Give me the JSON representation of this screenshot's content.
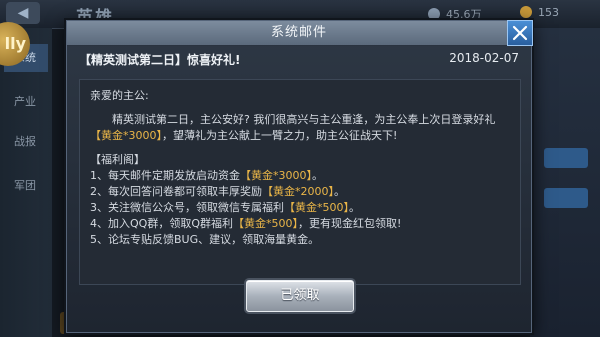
{
  "background": {
    "screen_title": "英雄",
    "resource_silver": "45.6万",
    "resource_gold": "153",
    "logo_text": "lly",
    "sidebar_items": [
      "系统",
      "产业",
      "战报",
      "军团"
    ]
  },
  "mail": {
    "header_title": "系统邮件",
    "subject": "【精英测试第二日】惊喜好礼!",
    "date": "2018-02-07",
    "greeting": "亲爱的主公:",
    "intro_a": "精英测试第二日，主公安好? 我们很高兴与主公重逢，为主公奉上次日登录好礼",
    "intro_gold": "【黄金*3000】",
    "intro_b": "，望薄礼为主公献上一臂之力，助主公征战天下!",
    "section_title": "【福利阁】",
    "items": [
      {
        "a": "1、每天邮件定期发放启动资金",
        "gold": "【黄金*3000】",
        "b": "。"
      },
      {
        "a": "2、每次回答问卷都可领取丰厚奖励",
        "gold": "【黄金*2000】",
        "b": "。"
      },
      {
        "a": "3、关注微信公众号，领取微信专属福利",
        "gold": "【黄金*500】",
        "b": "。"
      },
      {
        "a": "4、加入QQ群，领取Q群福利",
        "gold": "【黄金*500】",
        "b": "，更有现金红包领取!"
      },
      {
        "a": "5、论坛专贴反馈BUG、建议，领取海量黄金。",
        "gold": "",
        "b": ""
      }
    ],
    "claim_label": "已领取"
  },
  "colors": {
    "gold_text": "#e9b548",
    "close_button": "#3a7bc4"
  }
}
